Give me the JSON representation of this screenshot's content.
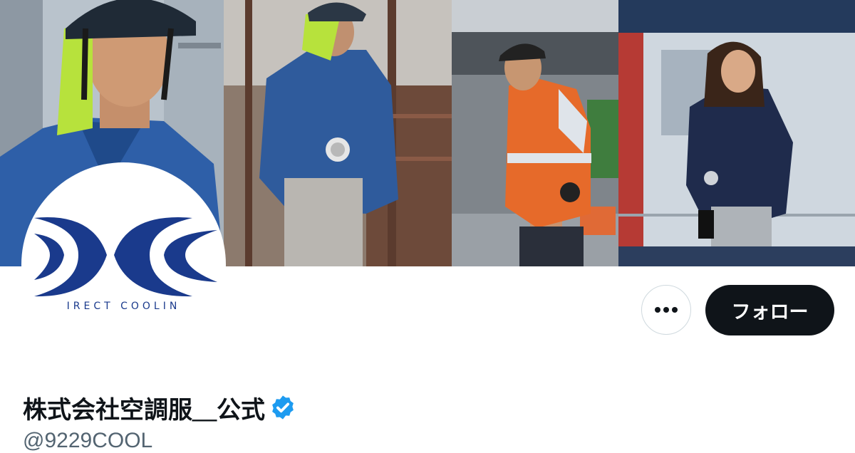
{
  "profile": {
    "display_name": "株式会社空調服＿公式",
    "handle": "@9229COOL",
    "verified": true,
    "avatar_logo_text": "IRECT COOLIN"
  },
  "actions": {
    "more_label": "•••",
    "follow_label": "フォロー"
  },
  "colors": {
    "follow_bg": "#0f1419",
    "verified_blue": "#1d9bf0",
    "logo_blue": "#1a3a8c",
    "handle_gray": "#536471"
  },
  "icons": {
    "more": "more-horizontal-icon",
    "verified": "verified-badge-icon"
  }
}
